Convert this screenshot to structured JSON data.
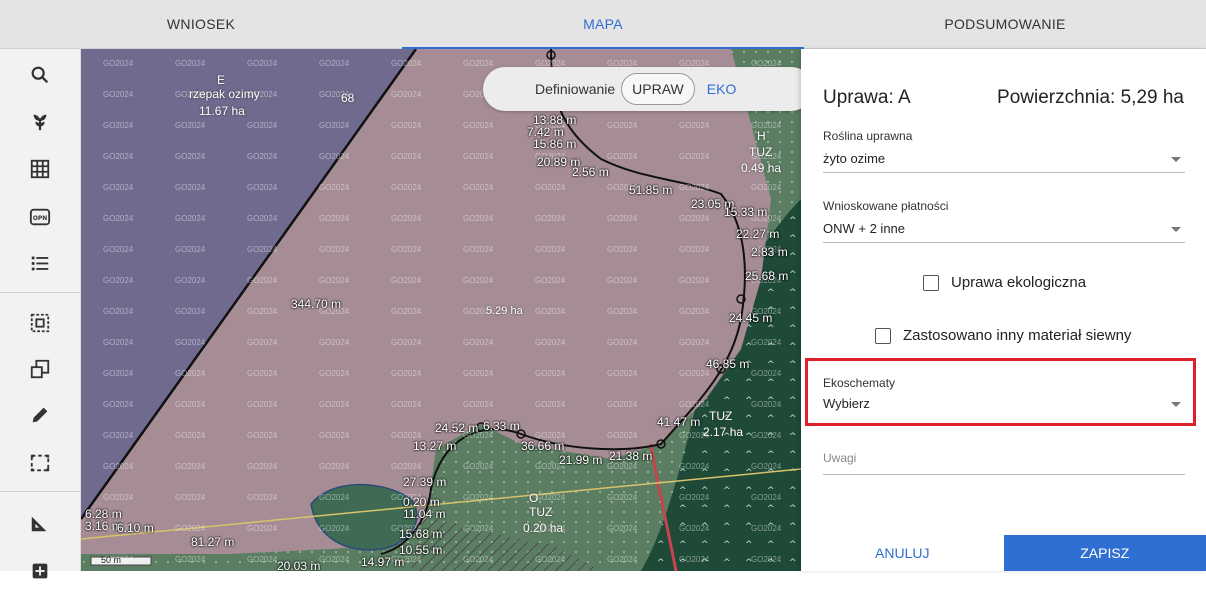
{
  "tabs": [
    {
      "label": "WNIOSEK"
    },
    {
      "label": "MAPA"
    },
    {
      "label": "PODSUMOWANIE"
    }
  ],
  "toolbar_icons": [
    "search-icon",
    "plant-icon",
    "grid-icon",
    "opn-icon",
    "list-icon",
    "select-area-icon",
    "copy-icon",
    "pencil-icon",
    "rectangle-select-icon",
    "measure-icon",
    "plus-icon"
  ],
  "toolbar": {
    "opn_text": "OPN"
  },
  "definition_toggle": {
    "label": "Definiowanie",
    "upraw": "UPRAW",
    "eko": "EKO"
  },
  "map": {
    "watermark": "GO2024",
    "parcel_e": {
      "letter": "E",
      "crop": "rzepak ozimy",
      "area": "11.67 ha",
      "code": "68"
    },
    "parcel_h": {
      "letter": "H",
      "type": "TUZ",
      "area": "0.49 ha"
    },
    "parcel_area_main": "5.29 ha",
    "parcel_tuz2": {
      "type": "TUZ",
      "area": "2.17 ha"
    },
    "parcel_o": {
      "letter": "O",
      "type": "TUZ",
      "area": "0.20 ha"
    },
    "measurements": [
      "13.88 m",
      "7.42 m",
      "15.86 m",
      "20.89 m",
      "2.56 m",
      "51.85 m",
      "23.05 m",
      "15.33 m",
      "22.27 m",
      "2.83 m",
      "25.68 m",
      "24.45 m",
      "46.85 m",
      "344.70 m",
      "41.47 m",
      "24.52 m",
      "6.33 m",
      "13.27 m",
      "36.66 m",
      "21.99 m",
      "21.38 m",
      "27.39 m",
      "0.20 m",
      "11.04 m",
      "15.68 m",
      "10.55 m",
      "14.97 m",
      "81.27 m",
      "20.03 m",
      "6.28 m",
      "3.16 m",
      "6.10 m"
    ],
    "scale": "50 m"
  },
  "panel": {
    "title": "Uprawa: A",
    "area": "Powierzchnia: 5,29 ha",
    "crop_label": "Roślina uprawna",
    "crop_value": "żyto ozime",
    "payments_label": "Wnioskowane płatności",
    "payments_value": "ONW + 2 inne",
    "eco_check": "Uprawa ekologiczna",
    "seed_check": "Zastosowano inny materiał siewny",
    "ecoschemes_label": "Ekoschematy",
    "ecoschemes_value": "Wybierz",
    "notes_placeholder": "Uwagi",
    "cancel": "ANULUJ",
    "save": "ZAPISZ"
  },
  "colors": {
    "accent": "#2f6fd1",
    "highlight": "#e0202a",
    "parcel_fill": "#a98f98",
    "grass": "#5d7e63"
  }
}
